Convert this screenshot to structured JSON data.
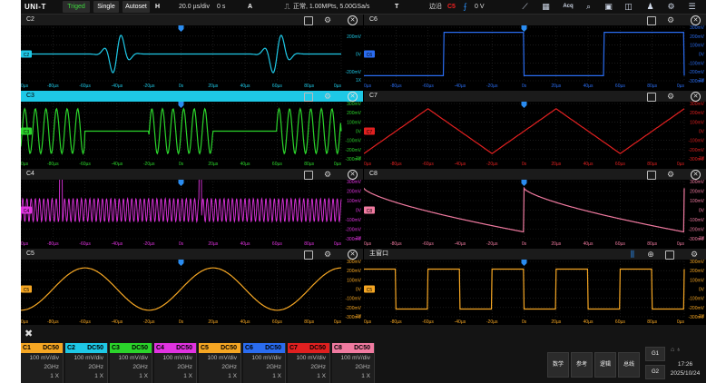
{
  "toolbar": {
    "logo": "UNI-T",
    "status": "Triged",
    "single": "Single",
    "autoset": "Autoset",
    "h_label": "H",
    "timebase": "20.0 µs/div",
    "h_offset": "0 s",
    "a_label": "A",
    "acq_info": "正常, 1.00MPts, 5.00GSa/s",
    "t_label": "T",
    "trig_mode": "边沿",
    "trig_source": "C5",
    "trig_level": "0 V",
    "acq_icon_label": "Acq"
  },
  "panels": {
    "c2": {
      "title": "C2",
      "tag": "C2"
    },
    "c6": {
      "title": "C6",
      "tag": "C6"
    },
    "c3": {
      "title": "C3",
      "tag": "C3"
    },
    "c7": {
      "title": "C7",
      "tag": "C7"
    },
    "c4": {
      "title": "C4",
      "tag": "C4"
    },
    "c8": {
      "title": "C8",
      "tag": "C8"
    },
    "c5": {
      "title": "C5",
      "tag": "C5"
    },
    "main": {
      "title": "主窗口",
      "tag": "C5"
    }
  },
  "xaxis_ticks": [
    "0µs",
    "-80µs",
    "-60µs",
    "-40µs",
    "-20µs",
    "0s",
    "20µs",
    "40µs",
    "60µs",
    "80µs",
    "0µs"
  ],
  "y_ticks": {
    "c2": [
      "200mV",
      "0V",
      "-200mV"
    ],
    "c6": [
      "300mV",
      "200mV",
      "100mV",
      "0V",
      "-100mV",
      "-200mV",
      "-300mV"
    ],
    "c3": [
      "300mV",
      "200mV",
      "100mV",
      "0V",
      "-100mV",
      "-200mV",
      "-300mV"
    ],
    "c7": [
      "300mV",
      "200mV",
      "100mV",
      "0V",
      "-100mV",
      "-200mV",
      "-300mV"
    ],
    "c4": [
      "300mV",
      "200mV",
      "100mV",
      "0V",
      "-100mV",
      "-200mV",
      "-300mV"
    ],
    "c8": [
      "300mV",
      "200mV",
      "100mV",
      "0V",
      "-100mV",
      "-200mV",
      "-300mV"
    ],
    "c5": [
      "300mV",
      "200mV",
      "100mV",
      "0V",
      "-100mV",
      "-200mV",
      "-300mV"
    ],
    "main": [
      "300mV",
      "200mV",
      "100mV",
      "0V",
      "-100mV",
      "-200mV",
      "-300mV"
    ]
  },
  "y_tick_edge": "1X",
  "channels": [
    {
      "name": "C1",
      "coupling": "DC50",
      "scale": "100 mV/div",
      "bw": "2GHz",
      "probe": "1 X"
    },
    {
      "name": "C2",
      "coupling": "DC50",
      "scale": "100 mV/div",
      "bw": "2GHz",
      "probe": "1 X"
    },
    {
      "name": "C3",
      "coupling": "DC50",
      "scale": "100 mV/div",
      "bw": "2GHz",
      "probe": "1 X"
    },
    {
      "name": "C4",
      "coupling": "DC50",
      "scale": "100 mV/div",
      "bw": "2GHz",
      "probe": "1 X"
    },
    {
      "name": "C5",
      "coupling": "DC50",
      "scale": "100 mV/div",
      "bw": "2GHz",
      "probe": "1 X"
    },
    {
      "name": "C6",
      "coupling": "DC50",
      "scale": "100 mV/div",
      "bw": "2GHz",
      "probe": "1 X"
    },
    {
      "name": "C7",
      "coupling": "DC50",
      "scale": "100 mV/div",
      "bw": "2GHz",
      "probe": "1 X"
    },
    {
      "name": "C8",
      "coupling": "DC50",
      "scale": "100 mV/div",
      "bw": "2GHz",
      "probe": "1 X"
    }
  ],
  "colors": {
    "C1": "#f5a623",
    "C2": "#1ec8e6",
    "C3": "#2bd42b",
    "C4": "#e033e0",
    "C5": "#f5a623",
    "C6": "#2a6cf0",
    "C7": "#e02020",
    "C8": "#f07aa0"
  },
  "func_buttons": {
    "math": "数学",
    "ref": "参考",
    "logic": "逻辑",
    "bus": "总线"
  },
  "g_buttons": {
    "g1": "G1",
    "g2": "G2"
  },
  "clock": {
    "time": "17:26",
    "date": "2025/10/24"
  }
}
